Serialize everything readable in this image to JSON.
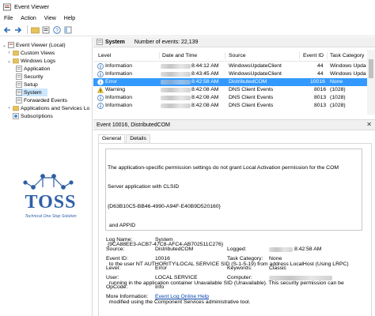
{
  "window": {
    "title": "Event Viewer"
  },
  "menu": [
    "File",
    "Action",
    "View",
    "Help"
  ],
  "tree": {
    "items": [
      {
        "label": "Event Viewer (Local)",
        "icon": "event-viewer-icon"
      },
      {
        "label": "Custom Views",
        "icon": "folder-icon"
      },
      {
        "label": "Windows Logs",
        "icon": "folder-icon"
      },
      {
        "label": "Application",
        "icon": "log-icon"
      },
      {
        "label": "Security",
        "icon": "log-icon"
      },
      {
        "label": "Setup",
        "icon": "log-icon"
      },
      {
        "label": "System",
        "icon": "log-icon",
        "selected": true
      },
      {
        "label": "Forwarded Events",
        "icon": "log-icon"
      },
      {
        "label": "Applications and Services Lo",
        "icon": "folder-icon"
      },
      {
        "label": "Subscriptions",
        "icon": "subscriptions-icon"
      }
    ]
  },
  "header": {
    "log_name": "System",
    "count_text": "Number of events: 22,139"
  },
  "table": {
    "columns": [
      "Level",
      "Date and Time",
      "Source",
      "Event ID",
      "Task Category"
    ],
    "rows": [
      {
        "level": "Information",
        "date": "8:44:12 AM",
        "source": "WindowsUpdateClient",
        "event_id": "44",
        "category": "Windows Upda"
      },
      {
        "level": "Information",
        "date": "8:43:45 AM",
        "source": "WindowsUpdateClient",
        "event_id": "44",
        "category": "Windows Upda"
      },
      {
        "level": "Error",
        "date": "8:42:58 AM",
        "source": "DistributedCOM",
        "event_id": "10016",
        "category": "None",
        "selected": true
      },
      {
        "level": "Warning",
        "date": "8:42:08 AM",
        "source": "DNS Client Events",
        "event_id": "8016",
        "category": "(1028)"
      },
      {
        "level": "Information",
        "date": "8:42:08 AM",
        "source": "DNS Client Events",
        "event_id": "8013",
        "category": "(1028)"
      },
      {
        "level": "Information",
        "date": "8:42:08 AM",
        "source": "DNS Client Events",
        "event_id": "8013",
        "category": "(1028)"
      }
    ]
  },
  "detail": {
    "title": "Event 10016, DistributedCOM",
    "tabs": [
      "General",
      "Details"
    ],
    "description_lines": [
      "The application-specific permission settings do not grant Local Activation permission for the COM",
      "Server application with CLSID",
      "{D63B10C5-BB46-4990-A94F-E40B9D520160}",
      " and APPID",
      "{9CA88EE3-ACB7-47C8-AFC4-AB702511C276}",
      " to the user NT AUTHORITY\\LOCAL SERVICE SID (S-1-5-19) from address LocalHost (Using LRPC)",
      " running in the application container Unavailable SID (Unavailable). This security permission can be",
      " modified using the Component Services administrative tool."
    ],
    "fields": {
      "log_name_label": "Log Name:",
      "log_name": "System",
      "source_label": "Source:",
      "source": "DistributedCOM",
      "logged_label": "Logged:",
      "logged": "8:42:58 AM",
      "event_id_label": "Event ID:",
      "event_id": "10016",
      "task_label": "Task Category:",
      "task": "None",
      "level_label": "Level:",
      "level": "Error",
      "keywords_label": "Keywords:",
      "keywords": "Classic",
      "user_label": "User:",
      "user": "LOCAL SERVICE",
      "computer_label": "Computer:",
      "opcode_label": "OpCode:",
      "opcode": "Info",
      "more_info_label": "More Information:",
      "more_info_link": "Event Log Online Help"
    }
  },
  "watermark": {
    "brand": "TOSS",
    "tagline": "Technical One Stop Solution"
  },
  "colors": {
    "selection": "#3399ff",
    "tree_selection": "#cce8ff",
    "link": "#0645ad",
    "watermark": "#2f5fa8"
  }
}
